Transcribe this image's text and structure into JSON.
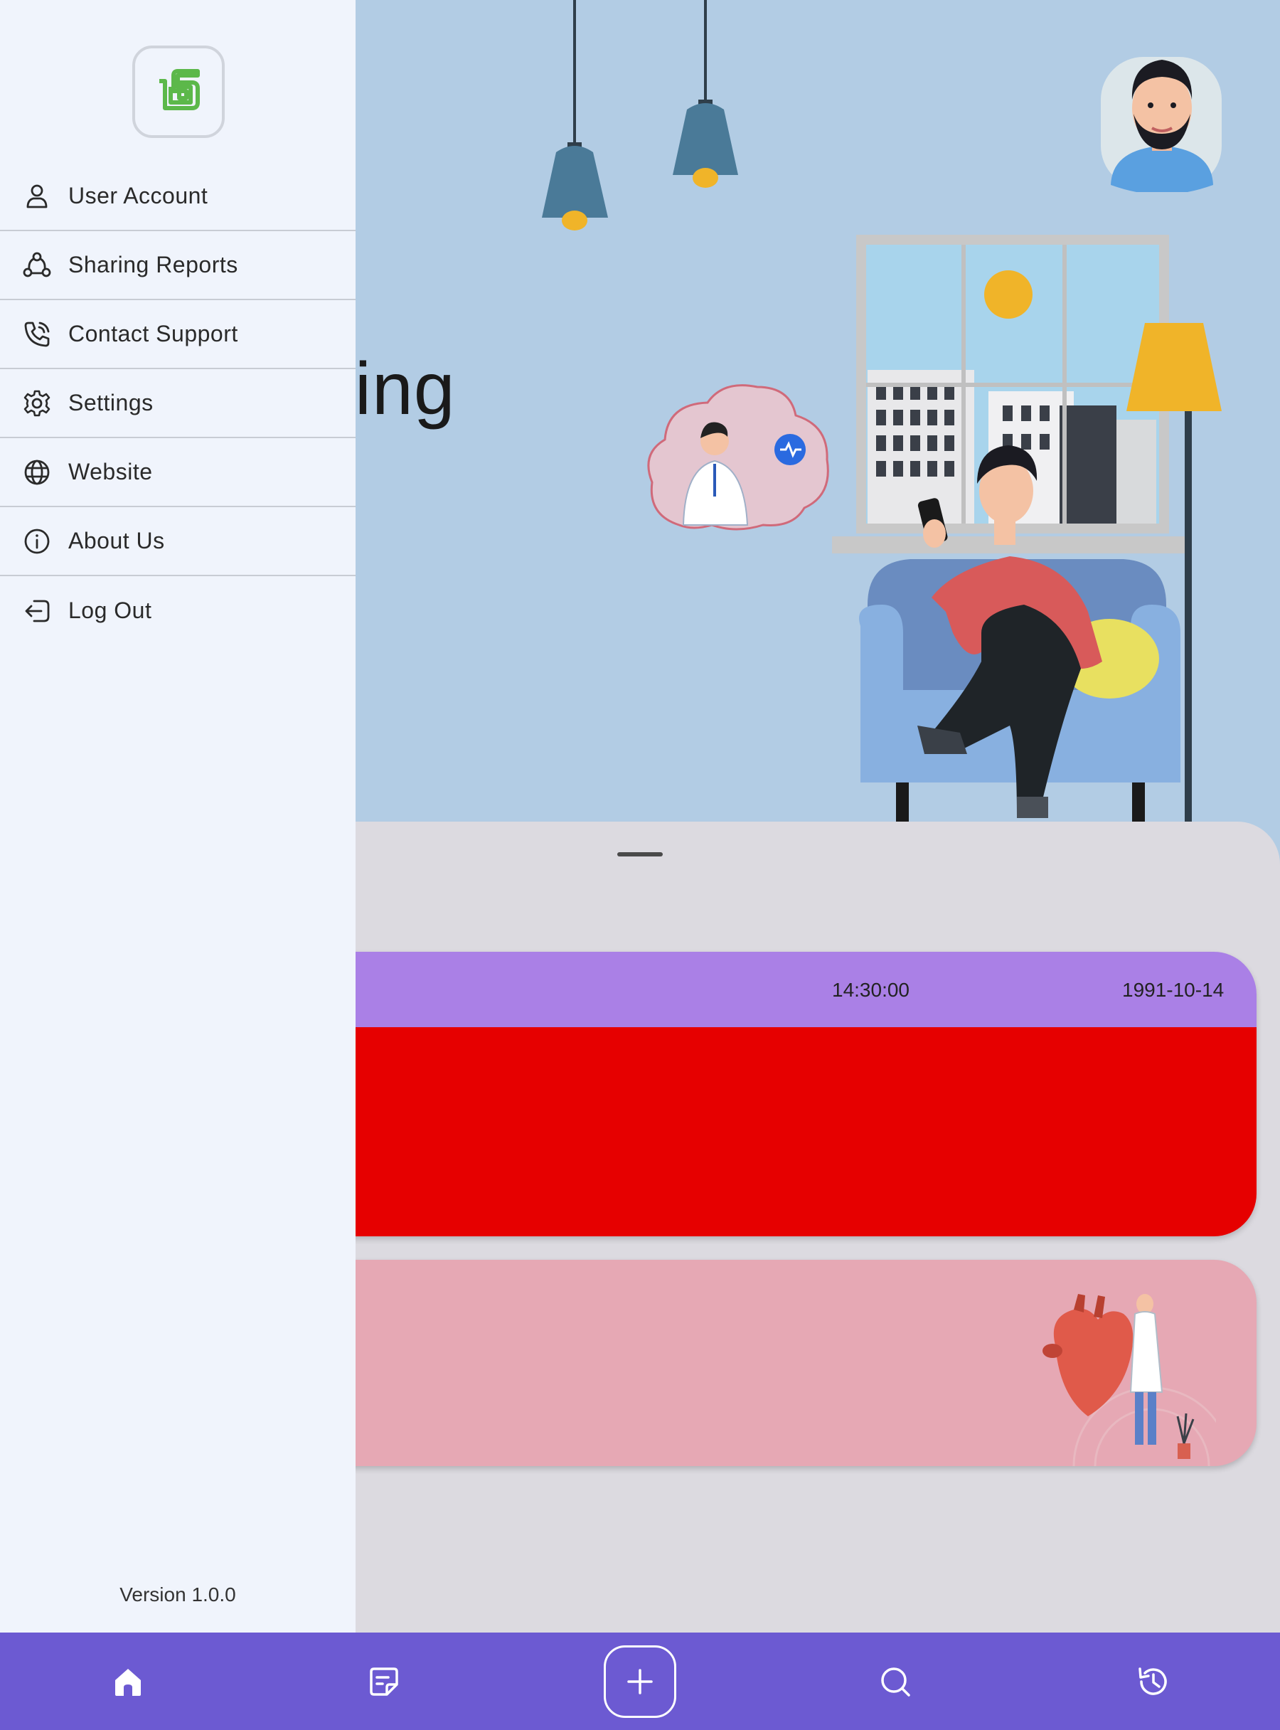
{
  "hero": {
    "heading": "ning"
  },
  "reading_card": {
    "time": "14:30:00",
    "date": "1991-10-14"
  },
  "drawer": {
    "menu": [
      {
        "label": "User Account",
        "icon": "user-icon"
      },
      {
        "label": "Sharing Reports",
        "icon": "share-icon"
      },
      {
        "label": "Contact Support",
        "icon": "phone-icon"
      },
      {
        "label": "Settings",
        "icon": "gear-icon"
      },
      {
        "label": "Website",
        "icon": "globe-icon"
      },
      {
        "label": "About Us",
        "icon": "info-icon"
      },
      {
        "label": "Log Out",
        "icon": "logout-icon"
      }
    ],
    "version": "Version 1.0.0"
  },
  "bottom_nav": {
    "items": [
      "home-icon",
      "notes-icon",
      "add-icon",
      "search-icon",
      "history-icon"
    ]
  },
  "colors": {
    "drawer_bg": "#f0f4fc",
    "hero_bg": "#b2cce4",
    "nav_bg": "#6c5ad2",
    "reading_header": "#aa80e6",
    "reading_body": "#e60000",
    "heart_card": "#e6a8b4",
    "logo_green": "#5cb84a"
  }
}
